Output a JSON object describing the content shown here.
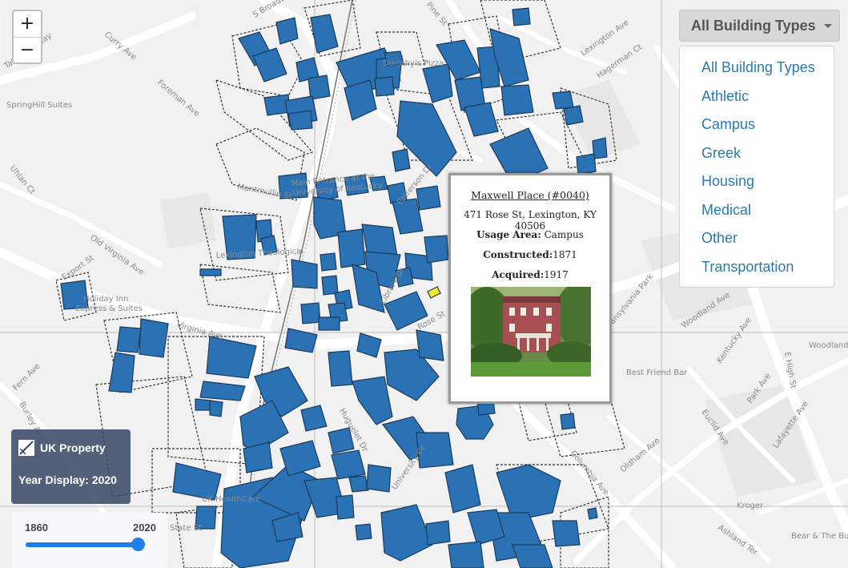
{
  "map": {
    "street_labels": [
      {
        "text": "S Broadway"
      },
      {
        "text": "Pine St"
      },
      {
        "text": "Curry Ave"
      },
      {
        "text": "Tattersall Way"
      },
      {
        "text": "SpringHill Suites"
      },
      {
        "text": "Foreman Ave"
      },
      {
        "text": "Lexington Ave"
      },
      {
        "text": "Hagerman Ct"
      },
      {
        "text": "Uhlan Ct"
      },
      {
        "text": "Montmullin St"
      },
      {
        "text": "Main Entrance at the University of Kentucky"
      },
      {
        "text": "Patterson Dr"
      },
      {
        "text": "Lexington Theological"
      },
      {
        "text": "Old Virginia Ave"
      },
      {
        "text": "Export St"
      },
      {
        "text": "Holiday Inn Express & Suites"
      },
      {
        "text": "Virginia Ave"
      },
      {
        "text": "Library Dr"
      },
      {
        "text": "Rose St"
      },
      {
        "text": "Fern Ave"
      },
      {
        "text": "Burley Ave"
      },
      {
        "text": "University Dr"
      },
      {
        "text": "Huguelet Dr"
      },
      {
        "text": "Columbia Ave"
      },
      {
        "text": "Oldham Ave"
      },
      {
        "text": "Park Ave"
      },
      {
        "text": "Euclid Ave"
      },
      {
        "text": "Lafayette Ave"
      },
      {
        "text": "Best Friend Bar"
      },
      {
        "text": "Kentucky Ave"
      },
      {
        "text": "Woodland Ave"
      },
      {
        "text": "E High St"
      },
      {
        "text": "Woodland Park"
      },
      {
        "text": "Transylvania Park"
      },
      {
        "text": "Kroger"
      },
      {
        "text": "Ashland Ter"
      },
      {
        "text": "Bear & The Butcher"
      },
      {
        "text": "UK HealthCare"
      },
      {
        "text": "Dorothy's Pizza"
      },
      {
        "text": "State St"
      }
    ]
  },
  "zoom": {
    "in_label": "+",
    "out_label": "−"
  },
  "filter": {
    "selected": "All Building Types",
    "options": [
      "All Building Types",
      "Athletic",
      "Campus",
      "Greek",
      "Housing",
      "Medical",
      "Other",
      "Transportation"
    ]
  },
  "popup": {
    "title": "Maxwell Place (#0040)",
    "address": "471 Rose St, Lexington, KY 40506",
    "usage_label": "Usage Area:",
    "usage_value": "Campus",
    "constructed_label": "Constructed:",
    "constructed_value": "1871",
    "acquired_label": "Acquired:",
    "acquired_value": "1917"
  },
  "info": {
    "title": "UK Property",
    "year_display": "Year Display: 2020"
  },
  "slider": {
    "min_label": "1860",
    "max_label": "2020",
    "min": 1860,
    "max": 2020,
    "value": 2020
  },
  "colors": {
    "building": "#2a72b3",
    "highlight": "#f5e72a",
    "slider": "#1f7ee8",
    "link": "#2a7ab0"
  }
}
